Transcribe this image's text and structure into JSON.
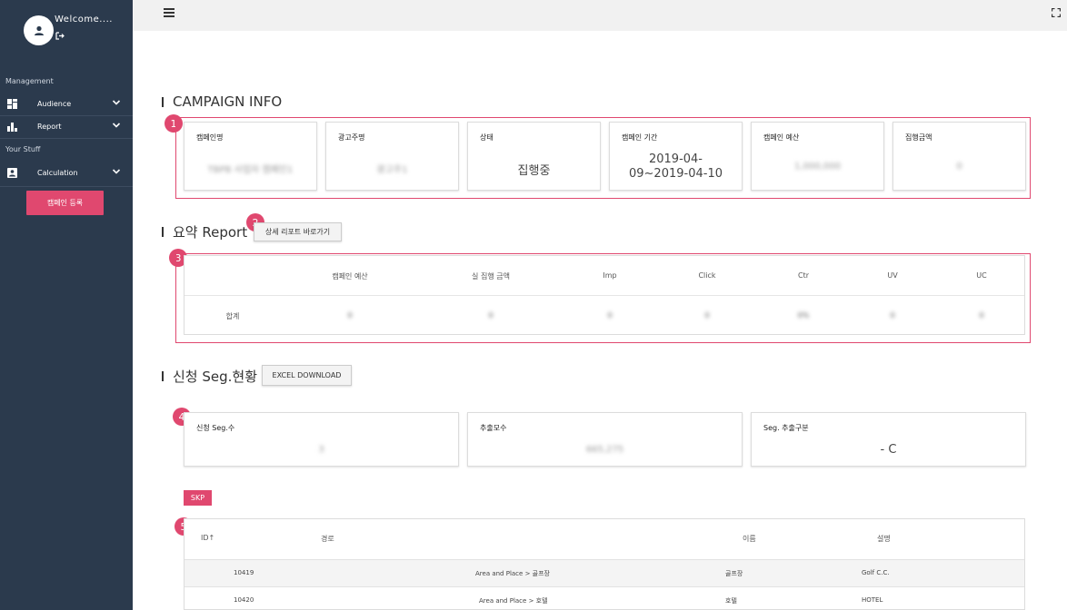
{
  "sidebar": {
    "welcome": "Welcome....",
    "management_label": "Management",
    "your_stuff_label": "Your Stuff",
    "items": [
      {
        "label": "Audience",
        "icon": "dashboard-icon"
      },
      {
        "label": "Report",
        "icon": "bar-chart-icon"
      },
      {
        "label": "Calculation",
        "icon": "account-box-icon"
      }
    ],
    "register_button": "캠페인 등록"
  },
  "campaign_info": {
    "title": "CAMPAIGN INFO",
    "badge": "1",
    "cards": [
      {
        "label": "캠페인명",
        "value": "TBPB 사업자 캠페인1"
      },
      {
        "label": "광고주명",
        "value": "광고주1"
      },
      {
        "label": "상태",
        "value": "집행중"
      },
      {
        "label": "캠페인 기간",
        "value_line1": "2019-04-",
        "value_line2": "09~2019-04-10"
      },
      {
        "label": "캠페인 예산",
        "value": "1,000,000"
      },
      {
        "label": "집행금액",
        "value": "0"
      }
    ]
  },
  "report": {
    "title": "요약 Report",
    "badge_button": "2",
    "detail_button": "상세 리포트 바로가기",
    "badge_table": "3",
    "headers": [
      "캠페인 예산",
      "실 집행 금액",
      "Imp",
      "Click",
      "Ctr",
      "UV",
      "UC"
    ],
    "row_label": "합계",
    "row_values": [
      "0",
      "0",
      "0",
      "0",
      "0%",
      "0",
      "0"
    ]
  },
  "segment": {
    "title": "신청 Seg.현황",
    "excel_button": "EXCEL DOWNLOAD",
    "badge": "4",
    "cards": [
      {
        "label": "신청 Seg.수",
        "value": "3"
      },
      {
        "label": "추출모수",
        "value": "665,275"
      },
      {
        "label": "Seg. 추출구분",
        "value": "- C"
      }
    ]
  },
  "skp": {
    "tag": "SKP",
    "badge": "5",
    "headers": {
      "id": "ID",
      "sort": "↑",
      "path": "경로",
      "name": "이름",
      "desc": "설명"
    },
    "rows": [
      {
        "id": "10419",
        "path": "Area and Place > 골프장",
        "name": "골프장",
        "desc": "Golf C.C."
      },
      {
        "id": "10420",
        "path": "Area and Place > 호텔",
        "name": "호텔",
        "desc": "HOTEL"
      }
    ]
  },
  "colors": {
    "sidebar": "#2b3a4d",
    "accent": "#e0486f",
    "topbar": "#f1f1f1"
  }
}
